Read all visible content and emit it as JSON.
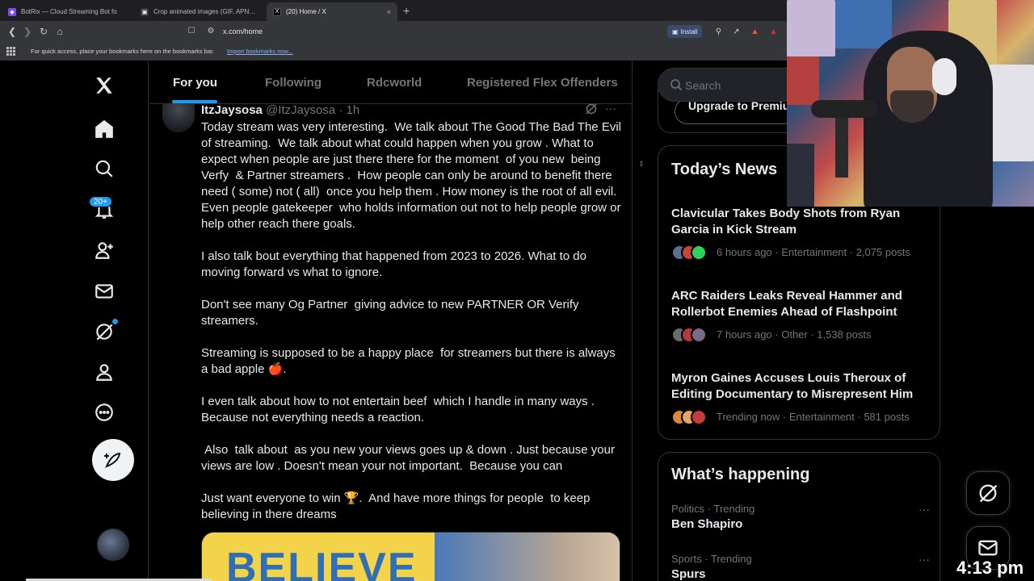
{
  "browser": {
    "tabs": [
      {
        "title": "BotRix — Cloud Streaming Bot fo",
        "active": false,
        "favicon_color": "#7b4df0"
      },
      {
        "title": "Crop animated images (GIF, APNG, W",
        "active": false,
        "favicon_color": "#3a3a3a"
      },
      {
        "title": "(20) Home / X",
        "active": true,
        "favicon_color": "#000000"
      }
    ],
    "new_tab_icon": "+",
    "close_icon": "×",
    "url": "x.com/home",
    "install_label": "Install",
    "bookmarks_hint": "For quick access, place your bookmarks here on the bookmarks bar.",
    "import_bookmarks_label": "Import bookmarks now..."
  },
  "nav": {
    "notifications_badge": "20+",
    "items": [
      "x-logo-icon",
      "home-icon",
      "explore-icon",
      "notifications-icon",
      "follow-icon",
      "messages-icon",
      "grok-icon",
      "profile-icon",
      "more-icon"
    ]
  },
  "feed": {
    "tabs": [
      {
        "label": "For you",
        "active": true
      },
      {
        "label": "Following",
        "active": false
      },
      {
        "label": "Rdcworld",
        "active": false
      },
      {
        "label": "Registered Flex Offenders",
        "active": false
      }
    ],
    "post": {
      "name": "ItzJaysosa",
      "handle": "@ItzJaysosa",
      "time": "1h",
      "more": "···",
      "paragraphs": [
        "Today stream was very interesting.  We talk about The Good The Bad The Evil of streaming.  We talk about what could happen when you grow . What to expect when people are just there there for the moment  of you new  being Verfy  & Partner streamers .  How people can only be around to benefit there need ( some) not ( all)  once you help them . How money is the root of all evil. Even people gatekeeper  who holds information out not to help people grow or help other reach there goals.",
        "",
        "I also talk bout everything that happened from 2023 to 2026. What to do moving forward vs what to ignore.",
        "",
        "Don't see many Og Partner  giving advice to new PARTNER OR Verify streamers.",
        "",
        "Streaming is supposed to be a happy place  for streamers but there is always a bad apple 🍎.",
        "",
        "I even talk about how to not entertain beef  which I handle in many ways . Because not everything needs a reaction.",
        "",
        " Also  talk about  as you new your views goes up & down . Just because your views are low . Doesn't mean your not important.  Because you can",
        "",
        "Just want everyone to win 🏆.  And have more things for people  to keep believing in there dreams"
      ],
      "media_text": "BELIEVE"
    }
  },
  "sidebar": {
    "search_placeholder": "Search",
    "premium_label": "Upgrade to Premium+",
    "news_title": "Today’s News",
    "news": [
      {
        "headline": "Clavicular Takes Body Shots from Ryan Garcia in Kick Stream",
        "meta": "6 hours ago · Entertainment · 2,075 posts",
        "face_colors": [
          "#5b6f8f",
          "#c9423c",
          "#2fd15a"
        ]
      },
      {
        "headline": "ARC Raiders Leaks Reveal Hammer and Rollerbot Enemies Ahead of Flashpoint",
        "meta": "7 hours ago · Other · 1,538 posts",
        "face_colors": [
          "#6b6b6b",
          "#b43b3b",
          "#7a6a8a"
        ]
      },
      {
        "headline": "Myron Gaines Accuses Louis Theroux of Editing Documentary to Misrepresent Him",
        "meta": "Trending now · Entertainment · 581 posts",
        "face_colors": [
          "#d9873b",
          "#e0a66a",
          "#c43c3c"
        ]
      }
    ],
    "happening_title": "What’s happening",
    "trends": [
      {
        "context": "Politics · Trending",
        "name": "Ben Shapiro"
      },
      {
        "context": "Sports · Trending",
        "name": "Spurs"
      }
    ],
    "trend_more": "···"
  },
  "overlay": {
    "clock": "4:13 pm"
  },
  "colors": {
    "accent": "#1d9bf0",
    "background": "#000000",
    "text": "#e7e9ea",
    "muted": "#71767b",
    "border": "#2f3336"
  }
}
